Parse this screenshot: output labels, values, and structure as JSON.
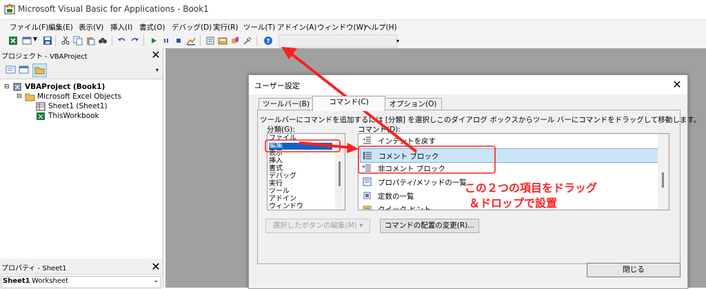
{
  "window": {
    "title": "Microsoft Visual Basic for Applications - Book1",
    "icon": "vba-app-icon"
  },
  "menu": [
    "ファイル(F)",
    "編集(E)",
    "表示(V)",
    "挿入(I)",
    "書式(O)",
    "デバッグ(D)",
    "実行(R)",
    "ツール(T)",
    "アドイン(A)",
    "ウィンドウ(W)",
    "ヘルプ(H)"
  ],
  "project_pane": {
    "title": "プロジェクト - VBAProject",
    "tree": {
      "root": "VBAProject (Book1)",
      "folder": "Microsoft Excel Objects",
      "items": [
        "Sheet1 (Sheet1)",
        "ThisWorkbook"
      ]
    }
  },
  "props_pane": {
    "title": "プロパティ - Sheet1",
    "object_name": "Sheet1",
    "object_type": "Worksheet"
  },
  "dialog": {
    "title": "ユーザー設定",
    "tabs": [
      "ツールバー(B)",
      "コマンド(C)",
      "オプション(O)"
    ],
    "active_tab": "コマンド(C)",
    "instruction": "ツールバーにコマンドを追加するには [分類] を選択しこのダイアログ ボックスからツール バーにコマンドをドラッグして移動します。",
    "category_label": "分類(G):",
    "commands_label": "コマンド(D):",
    "categories": [
      "ファイル",
      "編集",
      "表示",
      "挿入",
      "書式",
      "デバッグ",
      "実行",
      "ツール",
      "アドイン",
      "ウィンドウ"
    ],
    "selected_category": "編集",
    "commands": [
      {
        "label": "インデントを戻す",
        "icon": "outdent-icon"
      },
      {
        "label": "コメント ブロック",
        "icon": "comment-block-icon"
      },
      {
        "label": "非コメント ブロック",
        "icon": "uncomment-block-icon"
      },
      {
        "label": "プロパティ/メソッドの一覧",
        "icon": "list-members-icon"
      },
      {
        "label": "定数の一覧",
        "icon": "list-constants-icon"
      },
      {
        "label": "クイック ヒント",
        "icon": "quick-info-icon"
      }
    ],
    "selected_command": "コメント ブロック",
    "modify_selection_button": "選択したボタンの編集(M) ▾",
    "rearrange_button": "コマンドの配置の変更(R)...",
    "close_button": "閉じる"
  },
  "annotation": {
    "line1": "この２つの項目をドラッグ",
    "line2": "＆ドロップで設置",
    "color": "#ff2020"
  },
  "colors": {
    "workspace": "#a0a0a0",
    "selection": "#0a64c8",
    "command_selection": "#cce4f7"
  }
}
